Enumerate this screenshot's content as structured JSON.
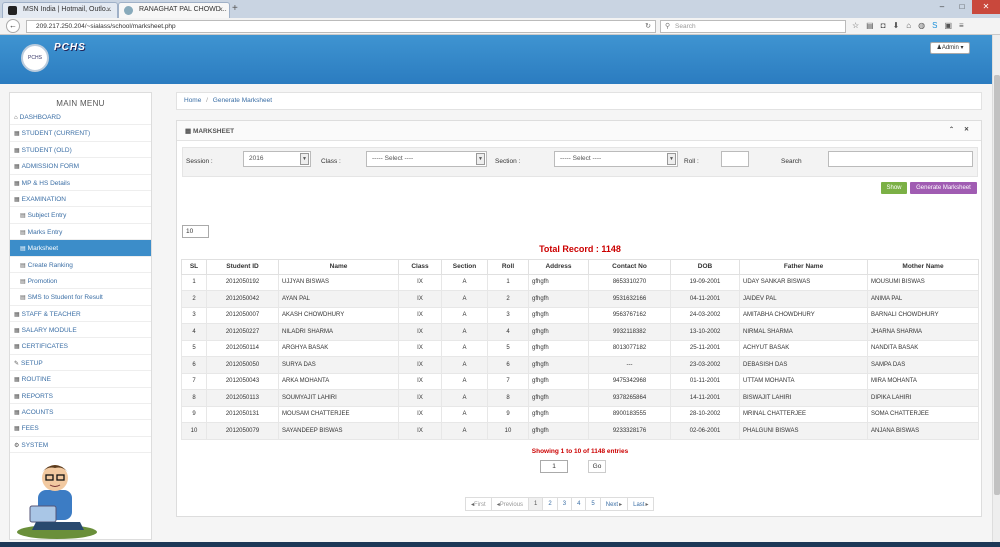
{
  "browser": {
    "tabs": [
      {
        "label": "MSN India | Hotmail, Outlo..."
      },
      {
        "label": "RANAGHAT PAL CHOWD..."
      }
    ],
    "url": "209.217.250.204/~sialass/school/marksheet.php",
    "search_placeholder": "Search"
  },
  "header": {
    "brand": "PCHS",
    "logo_text": "PCHS",
    "admin_label": "Admin"
  },
  "sidebar": {
    "title": "MAIN MENU",
    "items": [
      {
        "label": "DASHBOARD",
        "icon": "home-icon",
        "glyph": "⌂"
      },
      {
        "label": "STUDENT (CURRENT)",
        "icon": "grid-icon",
        "glyph": "▦"
      },
      {
        "label": "STUDENT (OLD)",
        "icon": "grid-icon",
        "glyph": "▦"
      },
      {
        "label": "ADMISSION FORM",
        "icon": "grid-icon",
        "glyph": "▦"
      },
      {
        "label": "MP & HS Details",
        "icon": "grid-icon",
        "glyph": "▦"
      },
      {
        "label": "EXAMINATION",
        "icon": "grid-icon",
        "glyph": "▦"
      },
      {
        "label": "Subject Entry",
        "icon": "list-icon",
        "glyph": "▤"
      },
      {
        "label": "Marks Entry",
        "icon": "list-icon",
        "glyph": "▤"
      },
      {
        "label": "Marksheet",
        "icon": "list-icon",
        "glyph": "▤"
      },
      {
        "label": "Create Ranking",
        "icon": "list-icon",
        "glyph": "▤"
      },
      {
        "label": "Promotion",
        "icon": "list-icon",
        "glyph": "▤"
      },
      {
        "label": "SMS to Student for Result",
        "icon": "list-icon",
        "glyph": "▤"
      },
      {
        "label": "STAFF & TEACHER",
        "icon": "grid-icon",
        "glyph": "▦"
      },
      {
        "label": "SALARY MODULE",
        "icon": "grid-icon",
        "glyph": "▦"
      },
      {
        "label": "CERTIFICATES",
        "icon": "grid-icon",
        "glyph": "▦"
      },
      {
        "label": "SETUP",
        "icon": "wrench-icon",
        "glyph": "✎"
      },
      {
        "label": "ROUTINE",
        "icon": "grid-icon",
        "glyph": "▦"
      },
      {
        "label": "REPORTS",
        "icon": "grid-icon",
        "glyph": "▦"
      },
      {
        "label": "ACOUNTS",
        "icon": "grid-icon",
        "glyph": "▦"
      },
      {
        "label": "FEES",
        "icon": "grid-icon",
        "glyph": "▦"
      },
      {
        "label": "SYSTEM",
        "icon": "cogs-icon",
        "glyph": "⚙"
      }
    ]
  },
  "breadcrumb": {
    "home": "Home",
    "separator": "/",
    "current": "Generate Marksheet"
  },
  "panel": {
    "title": "MARKSHEET"
  },
  "filters": {
    "session_label": "Session :",
    "session_value": "2016",
    "class_label": "Class :",
    "class_value": "----- Select ----",
    "section_label": "Section :",
    "section_value": "----- Select ----",
    "roll_label": "Roll :",
    "roll_value": "",
    "search_label": "Search",
    "search_value": ""
  },
  "buttons": {
    "show": "Show",
    "generate": "Generate Marksheet"
  },
  "per_page": "10",
  "total_record": "Total Record : 1148",
  "table": {
    "headers": [
      "SL",
      "Student ID",
      "Name",
      "Class",
      "Section",
      "Roll",
      "Address",
      "Contact No",
      "DOB",
      "Father Name",
      "Mother Name"
    ],
    "rows": [
      [
        "1",
        "2012050192",
        "UJJYAN BISWAS",
        "IX",
        "A",
        "1",
        "gfhgfh",
        "8653310270",
        "19-09-2001",
        "UDAY SANKAR BISWAS",
        "MOUSUMI BISWAS"
      ],
      [
        "2",
        "2012050042",
        "AYAN PAL",
        "IX",
        "A",
        "2",
        "gfhgfh",
        "9531632166",
        "04-11-2001",
        "JAIDEV PAL",
        "ANIMA PAL"
      ],
      [
        "3",
        "2012050007",
        "AKASH CHOWDHURY",
        "IX",
        "A",
        "3",
        "gfhgfh",
        "9563767162",
        "24-03-2002",
        "AMITABHA CHOWDHURY",
        "BARNALI CHOWDHURY"
      ],
      [
        "4",
        "2012050227",
        "NILADRI SHARMA",
        "IX",
        "A",
        "4",
        "gfhgfh",
        "9932118382",
        "13-10-2002",
        "NIRMAL SHARMA",
        "JHARNA SHARMA"
      ],
      [
        "5",
        "2012050114",
        "ARGHYA BASAK",
        "IX",
        "A",
        "5",
        "gfhgfh",
        "8013077182",
        "25-11-2001",
        "ACHYUT BASAK",
        "NANDITA BASAK"
      ],
      [
        "6",
        "2012050050",
        "SURYA DAS",
        "IX",
        "A",
        "6",
        "gfhgfh",
        "---",
        "23-03-2002",
        "DEBASISH DAS",
        "SAMPA DAS"
      ],
      [
        "7",
        "2012050043",
        "ARKA MOHANTA",
        "IX",
        "A",
        "7",
        "gfhgfh",
        "9475342968",
        "01-11-2001",
        "UTTAM MOHANTA",
        "MIRA MOHANTA"
      ],
      [
        "8",
        "2012050113",
        "SOUMYAJIT LAHIRI",
        "IX",
        "A",
        "8",
        "gfhgfh",
        "9378265864",
        "14-11-2001",
        "BISWAJIT LAHIRI",
        "DIPIKA LAHIRI"
      ],
      [
        "9",
        "2012050131",
        "MOUSAM CHATTERJEE",
        "IX",
        "A",
        "9",
        "gfhgfh",
        "8900183555",
        "28-10-2002",
        "MRINAL CHATTERJEE",
        "SOMA CHATTERJEE"
      ],
      [
        "10",
        "2012050079",
        "SAYANDEEP BISWAS",
        "IX",
        "A",
        "10",
        "gfhgfh",
        "9233328176",
        "02-06-2001",
        "PHALGUNI BISWAS",
        "ANJANA BISWAS"
      ]
    ]
  },
  "showing": "Showing 1 to 10 of 1148 entries",
  "goto": {
    "page": "1",
    "button": "Go"
  },
  "pagination": [
    "First",
    "Previous",
    "1",
    "2",
    "3",
    "4",
    "5",
    "Next",
    "Last"
  ]
}
